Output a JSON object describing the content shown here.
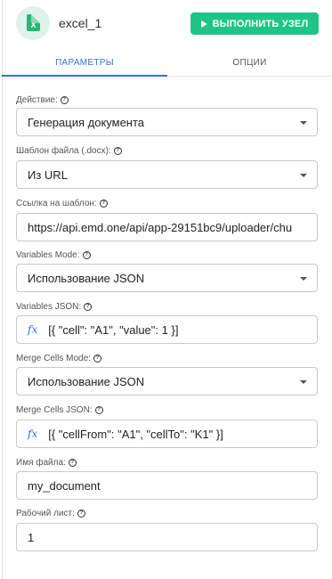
{
  "header": {
    "app_icon": "excel-file-icon",
    "app_icon_letter": "X",
    "title": "excel_1",
    "run_button_label": "ВЫПОЛНИТЬ УЗЕЛ"
  },
  "tabs": {
    "params": "ПАРАМЕТРЫ",
    "options": "ОПЦИИ",
    "active": "params"
  },
  "fields": {
    "action": {
      "label": "Действие:",
      "value": "Генерация документа"
    },
    "template_file": {
      "label": "Шаблон файла (.docx):",
      "value": "Из URL"
    },
    "template_link": {
      "label": "Ссылка на шаблон:",
      "value": "https://api.emd.one/api/app-29151bc9/uploader/chu"
    },
    "variables_mode": {
      "label": "Variables Mode:",
      "value": "Использование JSON"
    },
    "variables_json": {
      "label": "Variables JSON:",
      "fx": "fx",
      "value": "[{ \"cell\": \"A1\", \"value\": 1 }]"
    },
    "merge_cells_mode": {
      "label": "Merge Cells Mode:",
      "value": "Использование JSON"
    },
    "merge_cells_json": {
      "label": "Merge Cells JSON:",
      "fx": "fx",
      "value": "[{ \"cellFrom\": \"A1\", \"cellTo\": \"K1\" }]"
    },
    "file_name": {
      "label": "Имя файла:",
      "value": "my_document"
    },
    "worksheet": {
      "label": "Рабочий лист:",
      "value": "1"
    }
  },
  "colors": {
    "accent": "#3d6fd8",
    "run_button": "#1fc585",
    "icon_bg": "#dff3ea"
  }
}
